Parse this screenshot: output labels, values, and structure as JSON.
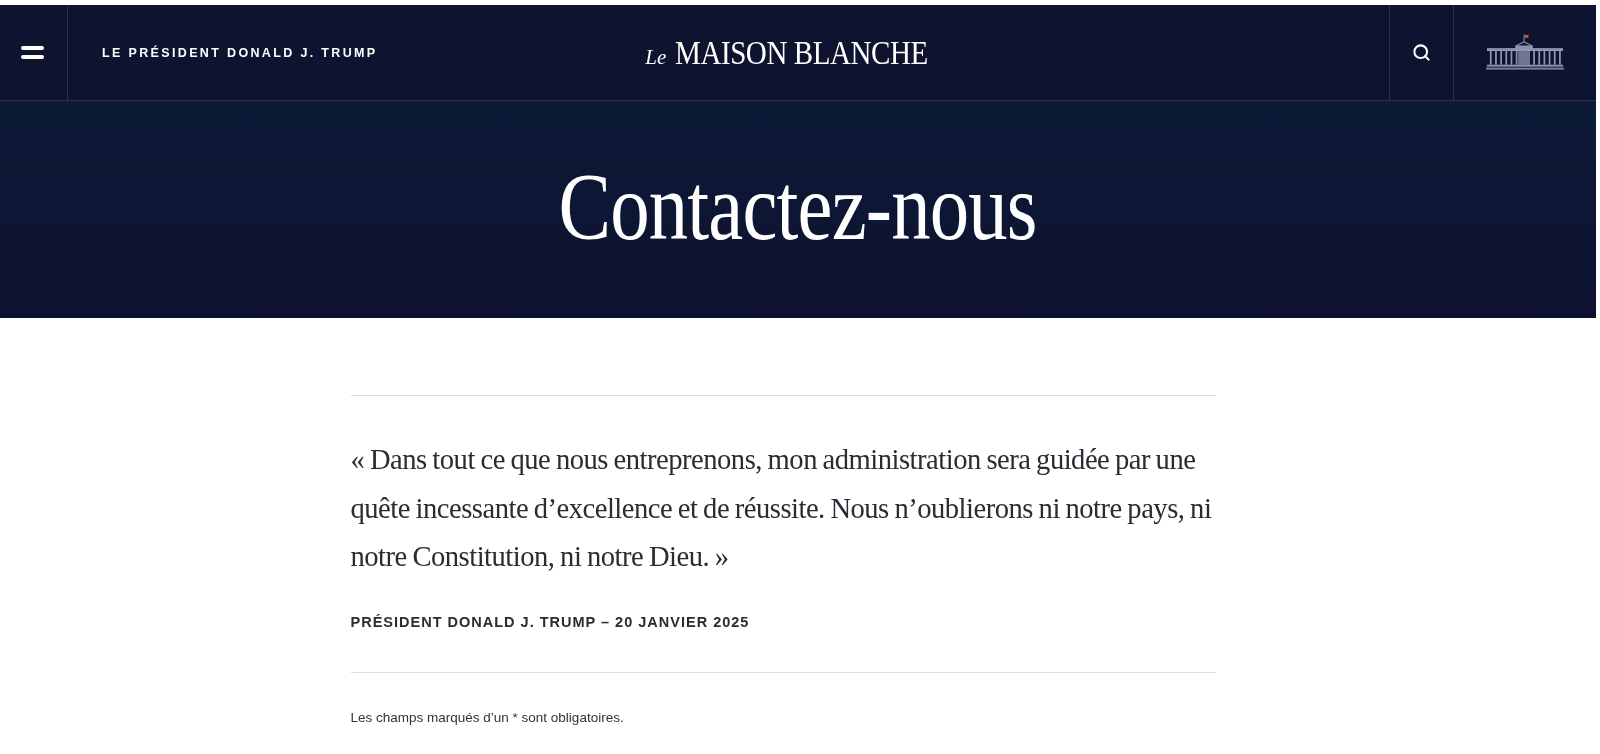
{
  "header": {
    "title": "LE PRÉSIDENT DONALD J. TRUMP",
    "logo": {
      "prefix": "Le",
      "name": "MAISON BLANCHE"
    }
  },
  "hero": {
    "title": "Contactez-nous"
  },
  "quote": {
    "text": "« Dans tout ce que nous entreprenons, mon administration sera guidée par une quête incessante d’excellence et de réussite. Nous n’oublierons ni notre pays, ni notre Constitution, ni notre Dieu. »",
    "attribution": "PRÉSIDENT DONALD J. TRUMP – 20 JANVIER 2025"
  },
  "form": {
    "required_note": "Les champs marqués d’un * sont obligatoires."
  }
}
